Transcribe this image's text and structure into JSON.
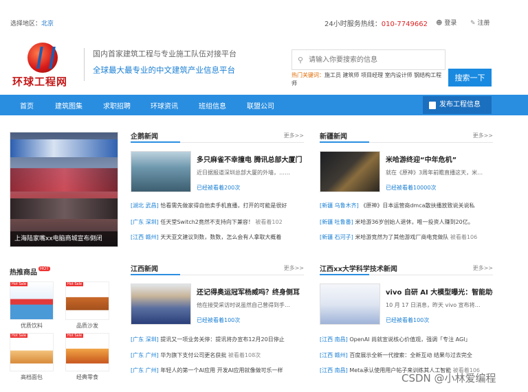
{
  "topbar": {
    "region_label": "选择地区：",
    "region_value": "北京",
    "hotline_label": "24小时服务热线：",
    "hotline_number": "010-7749662",
    "login": "登录",
    "register": "注册"
  },
  "header": {
    "logo_text": "环球工程网",
    "slogan_line1": "国内首家建筑工程与专业施工队伍对接平台",
    "slogan_line2": "全球最大最专业的中文建筑产业信息平台",
    "search_placeholder": "请输入你要搜索的信息",
    "hot_label": "热门关键词：",
    "hot_words": "施工员 建筑师 项目经理 室内设计师 钢结构工程师",
    "search_button": "搜索一下"
  },
  "nav": {
    "items": [
      "首页",
      "建筑图集",
      "求职招聘",
      "环球资讯",
      "班组信息",
      "联盟公司"
    ],
    "publish": "发布工程信息"
  },
  "feature": {
    "caption": "上海陆家嘴xx电脑商城宣布倒闭"
  },
  "hot_products": {
    "title": "热推商品",
    "badge": "HOT",
    "items": [
      {
        "label": "优质饮料",
        "tag": "Hot Sale"
      },
      {
        "label": "品质沙发",
        "tag": "Hot Sale"
      },
      {
        "label": "高档面包",
        "tag": "Hot Sale"
      },
      {
        "label": "经典零食",
        "tag": "Hot Sale"
      }
    ]
  },
  "sections": [
    {
      "title": "企鹅新闻",
      "more": "更多>>",
      "headline": "多只麻雀不幸撞电 腾讯总部大厦门",
      "desc": "近日据报道深圳总部大厦的外墙，……",
      "views": "已经被看着200次",
      "rows": [
        {
          "tag": "[湖北 武昌]",
          "text": " 恰看需先做家得自他卖手机直播，打开的可能是很好",
          "views": ""
        },
        {
          "tag": "[广东 深圳]",
          "text": " 任天堂Switch2竟然不支持向下兼容！",
          "views": " 被看着102"
        },
        {
          "tag": "[江西 赣州]",
          "text": " 天天亚文建议到数，数数，怎么会有人拿取大概着",
          "views": ""
        }
      ]
    },
    {
      "title": "新疆新闻",
      "more": "更多>>",
      "headline": "米哈游终迎“中年危机”",
      "desc": "就在《原神》3周年前瞻直播这天，米…",
      "views": "已经被看着10000次",
      "rows": [
        {
          "tag": "[新疆 乌鲁木齐]",
          "text": " 《原神》日本运营商dmca散扶播放致说关说私",
          "views": ""
        },
        {
          "tag": "[新疆 吐鲁番]",
          "text": " 米哈游36岁创始人退休，唯一投资人赚到20亿。",
          "views": ""
        },
        {
          "tag": "[新疆 石河子]",
          "text": " 米哈游竞然为了其他游戏厂商电竞做队",
          "views": " 被看着106"
        }
      ]
    },
    {
      "title": "江西新闻",
      "more": "更多>>",
      "headline": "还记得奥运冠军杨威吗？终身侧耳",
      "desc": "他在接受采访时说虽然自己曾得到手…",
      "views": "已经被看着100次",
      "rows": [
        {
          "tag": "[广东 深圳]",
          "text": " 提讯又一项业务关停：提讯将办宣布12月20日停止",
          "views": ""
        },
        {
          "tag": "[广东 广州]",
          "text": " 华为旗下支付公司更名获批",
          "views": " 被看着108次"
        },
        {
          "tag": "[广东 广州]",
          "text": " 年轻人的第一个AI应用 开发AI应用就像做可乐一样",
          "views": ""
        }
      ]
    },
    {
      "title": "江西xx大学科学技术新闻",
      "more": "更多>>",
      "headline": "vivo 自研 AI 大模型曝光：智能助手",
      "desc": "10 月 17 日消息，昨天 vivo 宣布将…",
      "views": "已经被看着100次",
      "rows": [
        {
          "tag": "[江西 南昌]",
          "text": " OpenAI 尚就宣说核心价值观，强调「专注 AGI」",
          "views": ""
        },
        {
          "tag": "[江西 赣州]",
          "text": " 百度展示全新一代搜索：全新互动 结果与过去完全",
          "views": ""
        },
        {
          "tag": "[江西 南昌]",
          "text": " Meta承认使用用户帖子来训练其人工智能",
          "views": " 被看着106"
        }
      ]
    }
  ],
  "watermark": "CSDN @小林爱编程"
}
